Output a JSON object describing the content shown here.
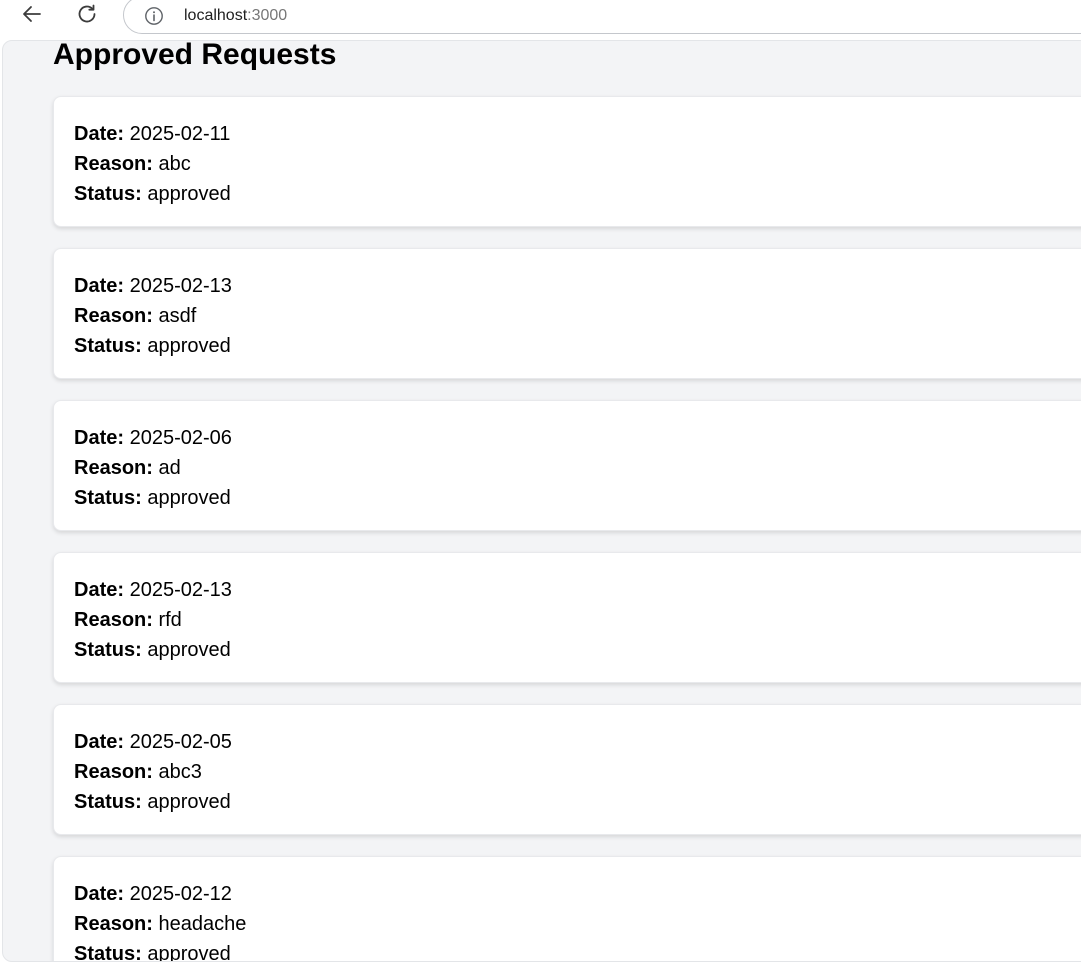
{
  "browser": {
    "url_host": "localhost",
    "url_port": ":3000",
    "back_icon": "arrow-left-icon",
    "reload_icon": "reload-icon",
    "info_icon": "info-icon"
  },
  "page": {
    "title": "Approved Requests",
    "labels": {
      "date": "Date:",
      "reason": "Reason:",
      "status": "Status:"
    },
    "requests": [
      {
        "date": "2025-02-11",
        "reason": "abc",
        "status": "approved"
      },
      {
        "date": "2025-02-13",
        "reason": "asdf",
        "status": "approved"
      },
      {
        "date": "2025-02-06",
        "reason": "ad",
        "status": "approved"
      },
      {
        "date": "2025-02-13",
        "reason": "rfd",
        "status": "approved"
      },
      {
        "date": "2025-02-05",
        "reason": "abc3",
        "status": "approved"
      },
      {
        "date": "2025-02-12",
        "reason": "headache",
        "status": "approved"
      }
    ]
  }
}
